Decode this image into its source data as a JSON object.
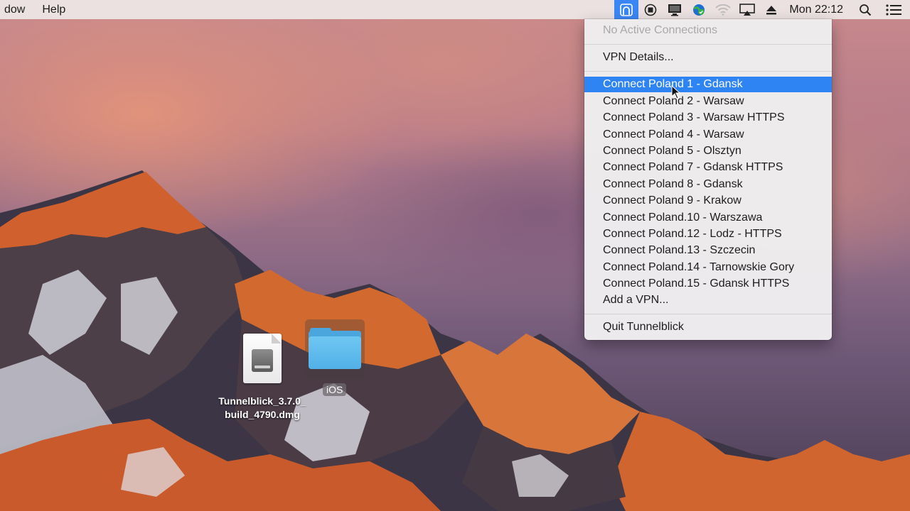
{
  "menubar": {
    "items": [
      "dow",
      "Help"
    ],
    "clock": "Mon 22:12"
  },
  "status_icons": [
    {
      "name": "tunnelblick-icon",
      "active": true
    },
    {
      "name": "record-icon",
      "active": false
    },
    {
      "name": "display-icon",
      "active": false
    },
    {
      "name": "vpn-status-icon",
      "active": false
    },
    {
      "name": "wifi-icon",
      "active": false
    },
    {
      "name": "airplay-icon",
      "active": false
    },
    {
      "name": "eject-icon",
      "active": false
    }
  ],
  "dropdown": {
    "status": "No Active Connections",
    "vpn_details": "VPN Details...",
    "connections": [
      "Connect Poland 1 - Gdansk",
      "Connect Poland 2 - Warsaw",
      "Connect Poland 3 - Warsaw HTTPS",
      "Connect Poland 4 - Warsaw",
      "Connect Poland 5 - Olsztyn",
      "Connect Poland 7 - Gdansk HTTPS",
      "Connect Poland 8 - Gdansk",
      "Connect Poland 9 - Krakow",
      "Connect Poland.10 - Warszawa",
      "Connect Poland.12 - Lodz - HTTPS",
      "Connect Poland.13 - Szczecin",
      "Connect Poland.14 - Tarnowskie Gory",
      "Connect Poland.15 - Gdansk HTTPS"
    ],
    "add_vpn": "Add a VPN...",
    "quit": "Quit Tunnelblick"
  },
  "desktop_icons": {
    "dmg_label_line1": "Tunnelblick_3.7.0_",
    "dmg_label_line2": "build_4790.dmg",
    "folder_label": "iOS"
  },
  "colors": {
    "highlight": "#2f84f4",
    "folder": "#5ab8ec"
  }
}
